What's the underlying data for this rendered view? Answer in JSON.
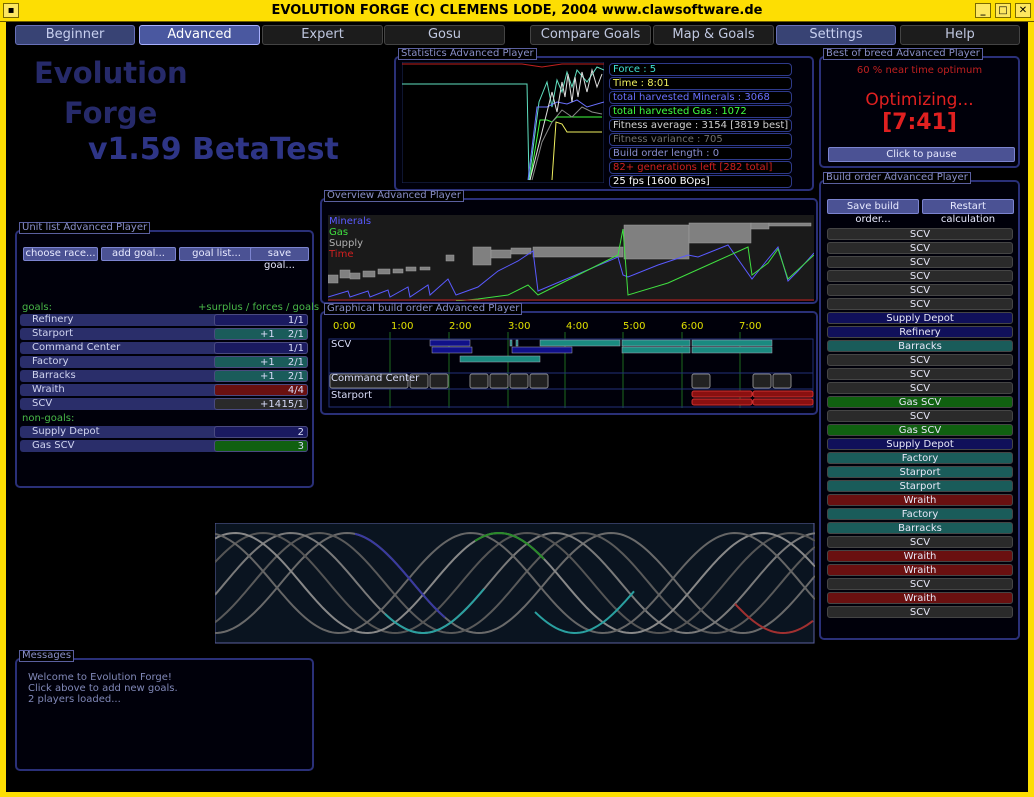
{
  "window": {
    "title": "EVOLUTION FORGE (C) CLEMENS LODE, 2004 www.clawsoftware.de"
  },
  "tabs": [
    {
      "label": "Beginner",
      "state": "normal"
    },
    {
      "label": "Advanced",
      "state": "active"
    },
    {
      "label": "Expert",
      "state": "plain"
    },
    {
      "label": "Gosu",
      "state": "plain"
    },
    {
      "label": "Compare Goals",
      "state": "plain"
    },
    {
      "label": "Map & Goals",
      "state": "plain"
    },
    {
      "label": "Settings",
      "state": "normal"
    },
    {
      "label": "Help",
      "state": "plain"
    }
  ],
  "logo": {
    "line1": "Evolution",
    "line2": "Forge",
    "line3": "v1.59 BetaTest"
  },
  "statistics": {
    "title": "Statistics Advanced Player",
    "rows": [
      {
        "text": "Force : 5",
        "color": "#40e0d0"
      },
      {
        "text": "Time : 8:01",
        "color": "#f0f060"
      },
      {
        "text": "total harvested Minerals : 3068",
        "color": "#6a70ff"
      },
      {
        "text": "total harvested Gas : 1072",
        "color": "#40ff40"
      },
      {
        "text": "Fitness average : 3154 [3819 best]",
        "color": "#d0d0d0"
      },
      {
        "text": "Fitness variance : 705",
        "color": "#707070"
      },
      {
        "text": "Build order length : 0",
        "color": "#8a90d0"
      },
      {
        "text": "82+ generations left [282 total]",
        "color": "#d02020"
      },
      {
        "text": "25 fps [1600 BOps]",
        "color": "#ffffff"
      }
    ]
  },
  "best": {
    "title": "Best of breed Advanced Player",
    "near": "60 % near time optimum",
    "status": "Optimizing...",
    "time": "[7:41]",
    "pause_label": "Click to pause"
  },
  "overview": {
    "title": "Overview Advanced Player",
    "legend": [
      {
        "label": "Minerals",
        "color": "#5a5aff"
      },
      {
        "label": "Gas",
        "color": "#40e040"
      },
      {
        "label": "Supply",
        "color": "#b0b0b0"
      },
      {
        "label": "Time",
        "color": "#d02020"
      }
    ]
  },
  "unitlist": {
    "title": "Unit list Advanced Player",
    "buttons": [
      "choose race...",
      "add goal...",
      "goal list...",
      "save goal..."
    ],
    "goals_label": "goals:",
    "goals_hint": "+surplus / forces / goals",
    "goals": [
      {
        "name": "Refinery",
        "surplus": "",
        "value": "1/1",
        "color": "#1a1a60"
      },
      {
        "name": "Starport",
        "surplus": "+1",
        "value": "2/1",
        "color": "#1a5c5a"
      },
      {
        "name": "Command Center",
        "surplus": "",
        "value": "1/1",
        "color": "#1a1a60"
      },
      {
        "name": "Factory",
        "surplus": "+1",
        "value": "2/1",
        "color": "#1a5c5a"
      },
      {
        "name": "Barracks",
        "surplus": "+1",
        "value": "2/1",
        "color": "#1a5c5a"
      },
      {
        "name": "Wraith",
        "surplus": "",
        "value": "4/4",
        "color": "#6a1010"
      },
      {
        "name": "SCV",
        "surplus": "+14",
        "value": "15/1",
        "color": "#2a2a2a"
      }
    ],
    "nongoals_label": "non-goals:",
    "nongoals": [
      {
        "name": "Supply Depot",
        "value": "2",
        "color": "#1a1a60"
      },
      {
        "name": "Gas SCV",
        "value": "3",
        "color": "#106010"
      }
    ]
  },
  "graphical": {
    "title": "Graphical build order Advanced Player",
    "ticks": [
      "0:00",
      "1:00",
      "2:00",
      "3:00",
      "4:00",
      "5:00",
      "6:00",
      "7:00"
    ],
    "rows": [
      "SCV",
      "Command Center",
      "Starport"
    ]
  },
  "buildorder": {
    "title": "Build order Advanced Player",
    "save_label": "Save build order...",
    "restart_label": "Restart calculation",
    "items": [
      {
        "name": "SCV",
        "color": "#2a2a2a"
      },
      {
        "name": "SCV",
        "color": "#2a2a2a"
      },
      {
        "name": "SCV",
        "color": "#2a2a2a"
      },
      {
        "name": "SCV",
        "color": "#2a2a2a"
      },
      {
        "name": "SCV",
        "color": "#2a2a2a"
      },
      {
        "name": "SCV",
        "color": "#2a2a2a"
      },
      {
        "name": "Supply Depot",
        "color": "#10105a"
      },
      {
        "name": "Refinery",
        "color": "#10105a"
      },
      {
        "name": "Barracks",
        "color": "#1a5c5a"
      },
      {
        "name": "SCV",
        "color": "#2a2a2a"
      },
      {
        "name": "SCV",
        "color": "#2a2a2a"
      },
      {
        "name": "SCV",
        "color": "#2a2a2a"
      },
      {
        "name": "Gas SCV",
        "color": "#106010"
      },
      {
        "name": "SCV",
        "color": "#2a2a2a"
      },
      {
        "name": "Gas SCV",
        "color": "#106010"
      },
      {
        "name": "Supply Depot",
        "color": "#10105a"
      },
      {
        "name": "Factory",
        "color": "#1a5c5a"
      },
      {
        "name": "Starport",
        "color": "#1a5c5a"
      },
      {
        "name": "Starport",
        "color": "#1a5c5a"
      },
      {
        "name": "Wraith",
        "color": "#6a1010"
      },
      {
        "name": "Factory",
        "color": "#1a5c5a"
      },
      {
        "name": "Barracks",
        "color": "#1a5c5a"
      },
      {
        "name": "SCV",
        "color": "#2a2a2a"
      },
      {
        "name": "Wraith",
        "color": "#6a1010"
      },
      {
        "name": "Wraith",
        "color": "#6a1010"
      },
      {
        "name": "SCV",
        "color": "#2a2a2a"
      },
      {
        "name": "Wraith",
        "color": "#6a1010"
      },
      {
        "name": "SCV",
        "color": "#2a2a2a"
      }
    ]
  },
  "messages": {
    "title": "Messages",
    "lines": [
      "Welcome to Evolution Forge!",
      "Click above to add new goals.",
      "2 players loaded..."
    ]
  }
}
